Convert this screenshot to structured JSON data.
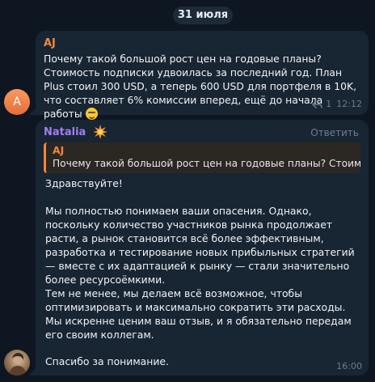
{
  "date": "31 июля",
  "avatars": {
    "aj_letter": "A"
  },
  "message1": {
    "sender": "AJ",
    "text": "Почему такой большой рост цен на годовые планы? Стоимость подписки удвоилась за последний год. План Plus стоил 300 USD, а теперь 600 USD для портфеля в 10K, что составляет 6% комиссии вперед, ещё до начала работы",
    "emoji": "grimacing-face-emoji",
    "reply_count": "1",
    "time": "12:12"
  },
  "message2": {
    "sender": "Natalia",
    "sender_badge": "sparkle-badge-icon",
    "reply_action": "Ответить",
    "quote": {
      "sender": "AJ",
      "text": "Почему такой большой рост цен на годовые планы? Стоимо..."
    },
    "paragraphs": [
      "Здравствуйте!",
      "Мы полностью понимаем ваши опасения. Однако, поскольку количество участников рынка продолжает расти, а рынок становится всё более эффективным, разработка и тестирование новых прибыльных стратегий — вместе с их адаптацией к рынку — стали значительно более ресурсоёмкими.",
      "Тем не менее, мы делаем всё возможное, чтобы оптимизировать и максимально сократить эти расходы. Мы искренне ценим ваш отзыв, и я обязательно передам его своим коллегам.",
      "Спасибо за понимание."
    ],
    "time": "16:00"
  },
  "colors": {
    "background": "#0e1621",
    "bubble": "#182533",
    "aj_name": "#f1873b",
    "natalia_name": "#a27ef0",
    "meta": "#6d7d8c"
  }
}
